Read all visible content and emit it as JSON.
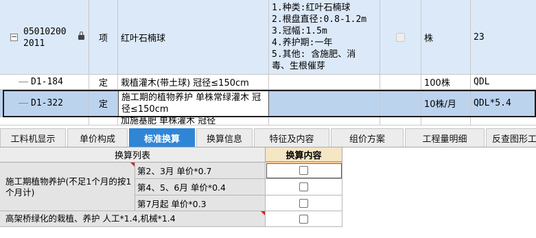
{
  "rows": [
    {
      "code": "05010200 2011",
      "code_line1": "05010200",
      "code_line2": "2011",
      "type": "项",
      "name": "红叶石楠球",
      "features": "1.种类:红叶石楠球\n2.根盘直径:0.8-1.2m\n3.冠幅:1.5m\n4.养护期:一年\n5.其他: 含施肥、消\n毒、生根催芽",
      "unit": "株",
      "qty": "23"
    },
    {
      "code": "D1-184",
      "type": "定",
      "name": "栽植灌木(带土球) 冠径≤150cm",
      "features": "",
      "unit": "100株",
      "qty": "QDL"
    },
    {
      "code": "D1-322",
      "type": "定",
      "name": "施工期的植物养护 单株常绿灌木 冠径≤150cm",
      "features": "",
      "unit": "10株/月",
      "qty": "QDL*5.4"
    },
    {
      "code": "",
      "type": "",
      "name": "加施基肥 单株灌木 冠径",
      "features": "",
      "unit": "",
      "qty": ""
    }
  ],
  "tabs": [
    {
      "label": "工料机显示",
      "active": false
    },
    {
      "label": "单价构成",
      "active": false
    },
    {
      "label": "标准换算",
      "active": true
    },
    {
      "label": "换算信息",
      "active": false
    },
    {
      "label": "特征及内容",
      "active": false
    },
    {
      "label": "组价方案",
      "active": false
    },
    {
      "label": "工程量明细",
      "active": false
    },
    {
      "label": "反查图形工程量",
      "active": false
    }
  ],
  "calc": {
    "header_list": "换算列表",
    "header_content": "换算内容",
    "groups": [
      {
        "label": "施工期植物养护(不足1个月的按1个月计)",
        "options": [
          {
            "label": "第2、3月 单价*0.7",
            "checked": false
          },
          {
            "label": "第4、5、6月 单价*0.4",
            "checked": false
          },
          {
            "label": "第7月起 单价*0.3",
            "checked": false
          }
        ]
      },
      {
        "label": "高架桥绿化的栽植、养护 人工*1.4,机械*1.4",
        "options": [
          {
            "label": "",
            "checked": false
          }
        ]
      }
    ]
  },
  "colors": {
    "row_parent_bg": "#dce9f8",
    "row_selected_bg": "#bcd3ee",
    "tab_active_bg": "#2f86d6",
    "content_header_bg": "#f5e6c4",
    "marker_red": "#e02020"
  }
}
